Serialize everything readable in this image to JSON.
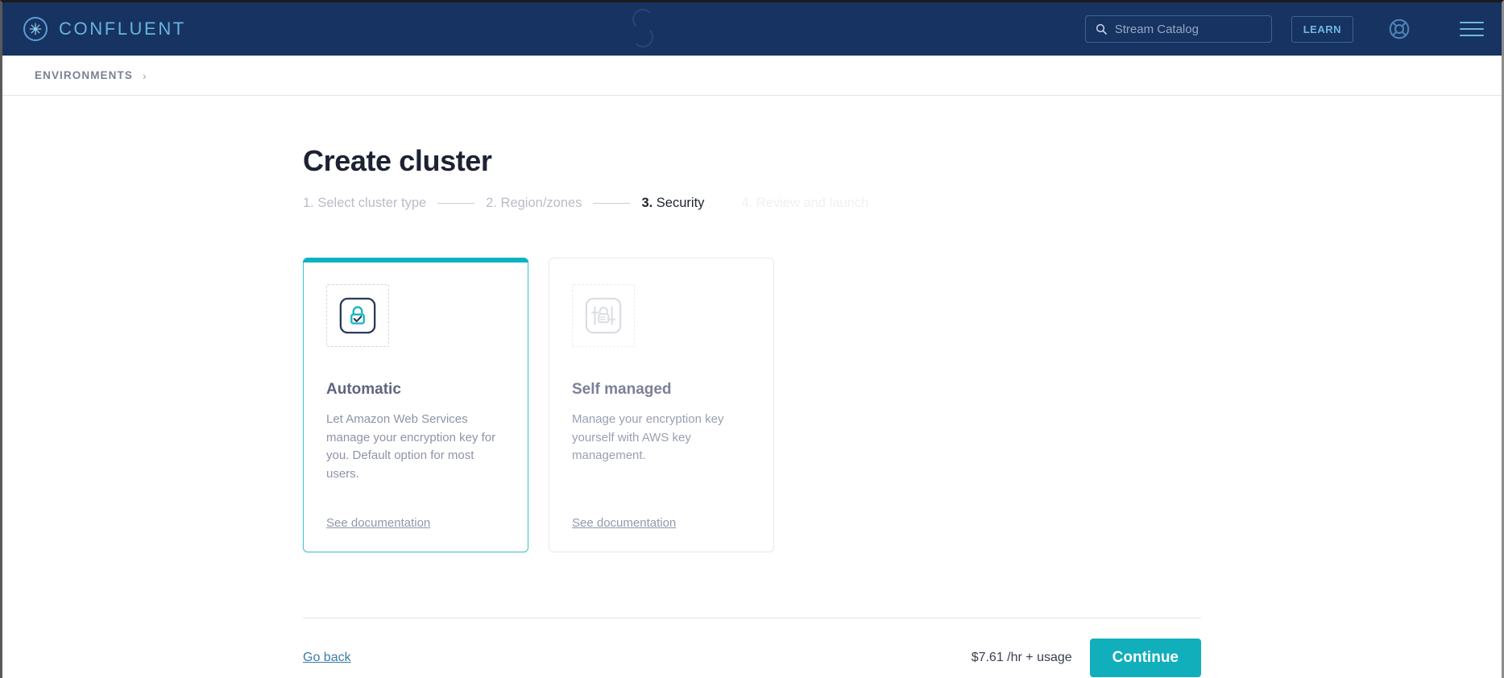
{
  "topnav": {
    "brand_name": "CONFLUENT",
    "brand_icon": "confluent-logo-icon",
    "search_placeholder": "Stream Catalog",
    "search_value": "",
    "search_icon": "search-icon",
    "learn_label": "LEARN",
    "help_icon": "lifebuoy-help-icon",
    "menu_icon": "hamburger-menu-icon",
    "background_color": "#173361",
    "accent_color": "#67b4e0"
  },
  "breadcrumb": {
    "items": [
      {
        "label": "ENVIRONMENTS"
      }
    ],
    "separator": "›"
  },
  "page": {
    "title": "Create cluster"
  },
  "stepper": {
    "steps": [
      {
        "num": "1.",
        "label": "Select cluster type",
        "state": "done"
      },
      {
        "num": "2.",
        "label": "Region/zones",
        "state": "done"
      },
      {
        "num": "3.",
        "label": "Security",
        "state": "active"
      },
      {
        "num": "4.",
        "label": "Review and launch",
        "state": "upcoming"
      }
    ]
  },
  "cards": [
    {
      "title": "Automatic",
      "description": "Let Amazon Web Services manage your encryption key for you. Default option for most users.",
      "link_label": "See documentation",
      "icon": "lock-check-icon",
      "selected": true,
      "accent_color": "#0bb3c0"
    },
    {
      "title": "Self managed",
      "description": "Manage your encryption key yourself with AWS key management.",
      "link_label": "See documentation",
      "icon": "lock-sliders-icon",
      "selected": false,
      "accent_color": "#d8dae2"
    }
  ],
  "footer": {
    "go_back_label": "Go back",
    "price_label": "$7.61 /hr + usage",
    "continue_label": "Continue",
    "continue_color": "#11aebb"
  }
}
